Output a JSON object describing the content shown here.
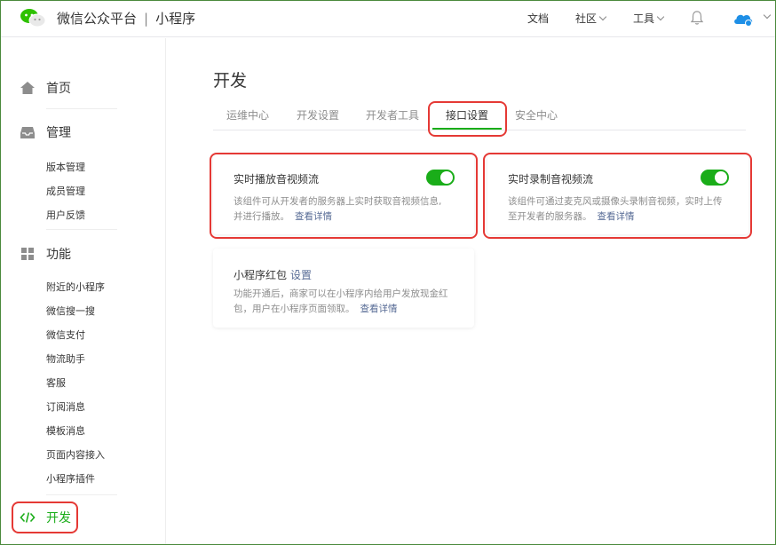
{
  "header": {
    "title": "微信公众平台",
    "separator": "|",
    "subtitle": "小程序",
    "nav": {
      "docs": "文档",
      "community": "社区",
      "tools": "工具"
    },
    "icons": {
      "logo": "wechat-logo-icon",
      "bell": "bell-icon",
      "avatar": "cloud-avatar-icon"
    }
  },
  "sidebar": {
    "home": "首页",
    "manage": "管理",
    "manage_items": [
      "版本管理",
      "成员管理",
      "用户反馈"
    ],
    "features": "功能",
    "feature_items": [
      "附近的小程序",
      "微信搜一搜",
      "微信支付",
      "物流助手",
      "客服",
      "订阅消息",
      "模板消息",
      "页面内容接入",
      "小程序插件"
    ],
    "develop": "开发"
  },
  "main": {
    "title": "开发",
    "tabs": [
      "运维中心",
      "开发设置",
      "开发者工具",
      "接口设置",
      "安全中心"
    ],
    "active_tab": "接口设置",
    "cards": [
      {
        "title": "实时播放音视频流",
        "desc_line1": "该组件可从开发者的服务器上实时获取音视频信息,",
        "desc_line2": "并进行播放。",
        "link": "查看详情",
        "enabled": true
      },
      {
        "title": "实时录制音视频流",
        "desc_line1": "该组件可通过麦克风或摄像头录制音视频，实时上传",
        "desc_line2": "至开发者的服务器。",
        "link": "查看详情",
        "enabled": true
      },
      {
        "title": "小程序红包",
        "title_link": "设置",
        "desc_line1": "功能开通后，商家可以在小程序内给用户发放现金红",
        "desc_line2": "包，用户在小程序页面领取。",
        "link": "查看详情"
      }
    ]
  },
  "colors": {
    "accent": "#1aad19",
    "link": "#576b95",
    "highlight": "#e53935"
  }
}
